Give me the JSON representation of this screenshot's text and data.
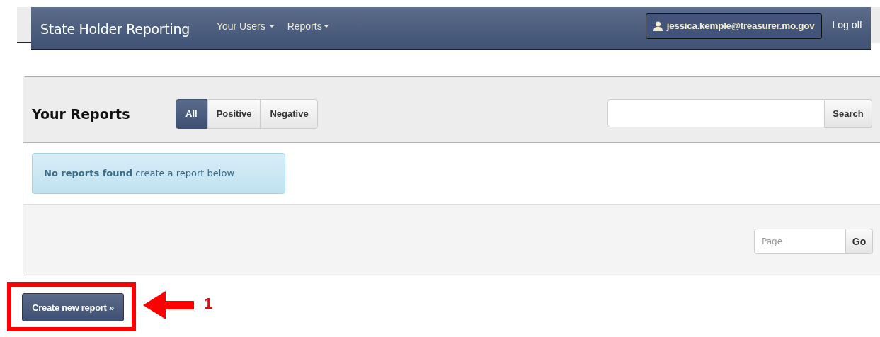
{
  "navbar": {
    "brand": "State Holder Reporting",
    "menus": [
      {
        "label": "Your Users"
      },
      {
        "label": "Reports"
      }
    ],
    "user": "jessica.kemple@treasurer.mo.gov",
    "logoff": "Log off"
  },
  "panel": {
    "title": "Your Reports",
    "filters": [
      {
        "label": "All",
        "selected": true
      },
      {
        "label": "Positive",
        "selected": false
      },
      {
        "label": "Negative",
        "selected": false
      }
    ],
    "search_button": "Search",
    "alert": "**No reports found** create a report below",
    "page_placeholder": "Page",
    "go_button": "Go"
  },
  "create_button": "Create new report »",
  "annotation": {
    "number": "1"
  }
}
